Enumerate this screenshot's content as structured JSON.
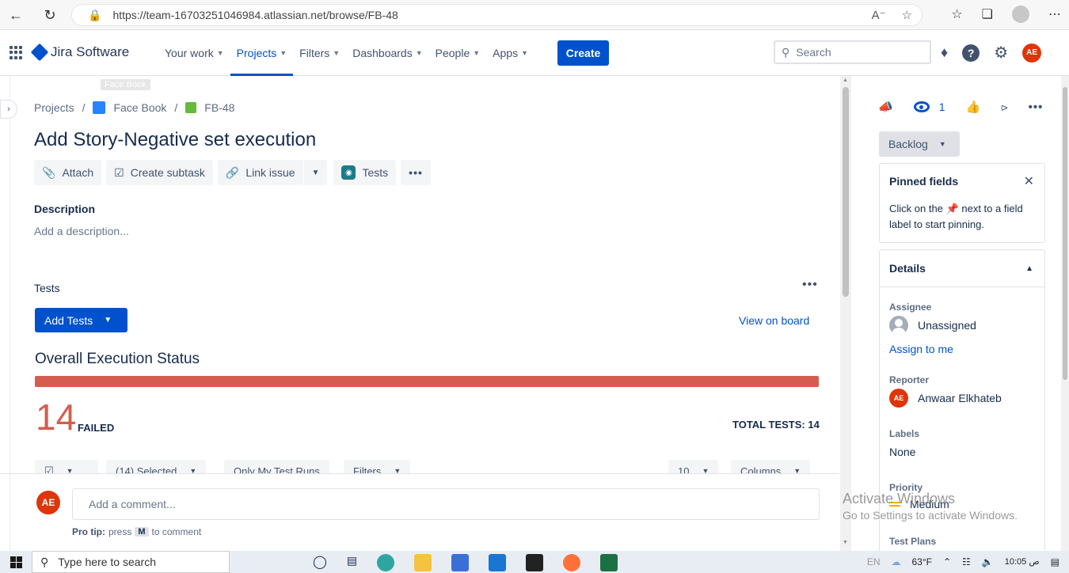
{
  "browser": {
    "url": "https://team-16703251046984.atlassian.net/browse/FB-48",
    "back_icon": "arrow-left-icon",
    "refresh_icon": "refresh-icon"
  },
  "nav": {
    "logo": "Jira Software",
    "items": [
      {
        "label": "Your work"
      },
      {
        "label": "Projects",
        "active": true
      },
      {
        "label": "Filters"
      },
      {
        "label": "Dashboards"
      },
      {
        "label": "People"
      },
      {
        "label": "Apps"
      }
    ],
    "create": "Create",
    "search_placeholder": "Search",
    "user_initials": "AE"
  },
  "tooltip": "Face Book",
  "breadcrumb": {
    "projects": "Projects",
    "project": "Face Book",
    "issue": "FB-48"
  },
  "issue": {
    "title": "Add Story-Negative set execution",
    "toolbar": {
      "attach": "Attach",
      "create_subtask": "Create subtask",
      "link_issue": "Link issue",
      "tests": "Tests"
    },
    "description_label": "Description",
    "description_placeholder": "Add a description...",
    "tests_label": "Tests",
    "add_tests": "Add Tests",
    "view_on_board": "View on board",
    "overall_title": "Overall Execution Status",
    "failed_count": "14",
    "failed_label": "FAILED",
    "total_tests": "TOTAL TESTS: 14",
    "filters": {
      "selected": "(14) Selected",
      "only_my": "Only My Test Runs",
      "filters": "Filters",
      "page_size": "10",
      "columns": "Columns"
    }
  },
  "comment": {
    "initials": "AE",
    "placeholder": "Add a comment...",
    "pro_tip_label": "Pro tip:",
    "pro_tip_press": "press",
    "pro_tip_key": "M",
    "pro_tip_suffix": "to comment"
  },
  "right_panel": {
    "watch_count": "1",
    "status": "Backlog",
    "pinned_title": "Pinned fields",
    "pinned_desc_1": "Click on the",
    "pinned_desc_2": "next to a field label to start pinning.",
    "details_title": "Details",
    "assignee_label": "Assignee",
    "assignee_value": "Unassigned",
    "assign_to_me": "Assign to me",
    "reporter_label": "Reporter",
    "reporter_initials": "AE",
    "reporter_value": "Anwaar Elkhateb",
    "labels_label": "Labels",
    "labels_value": "None",
    "priority_label": "Priority",
    "priority_value": "Medium",
    "test_plans_label": "Test Plans"
  },
  "watermark": {
    "title": "Activate Windows",
    "subtitle": "Go to Settings to activate Windows."
  },
  "taskbar": {
    "search_placeholder": "Type here to search",
    "lang": "EN",
    "temperature": "63°F",
    "time": "10:05 ص"
  }
}
